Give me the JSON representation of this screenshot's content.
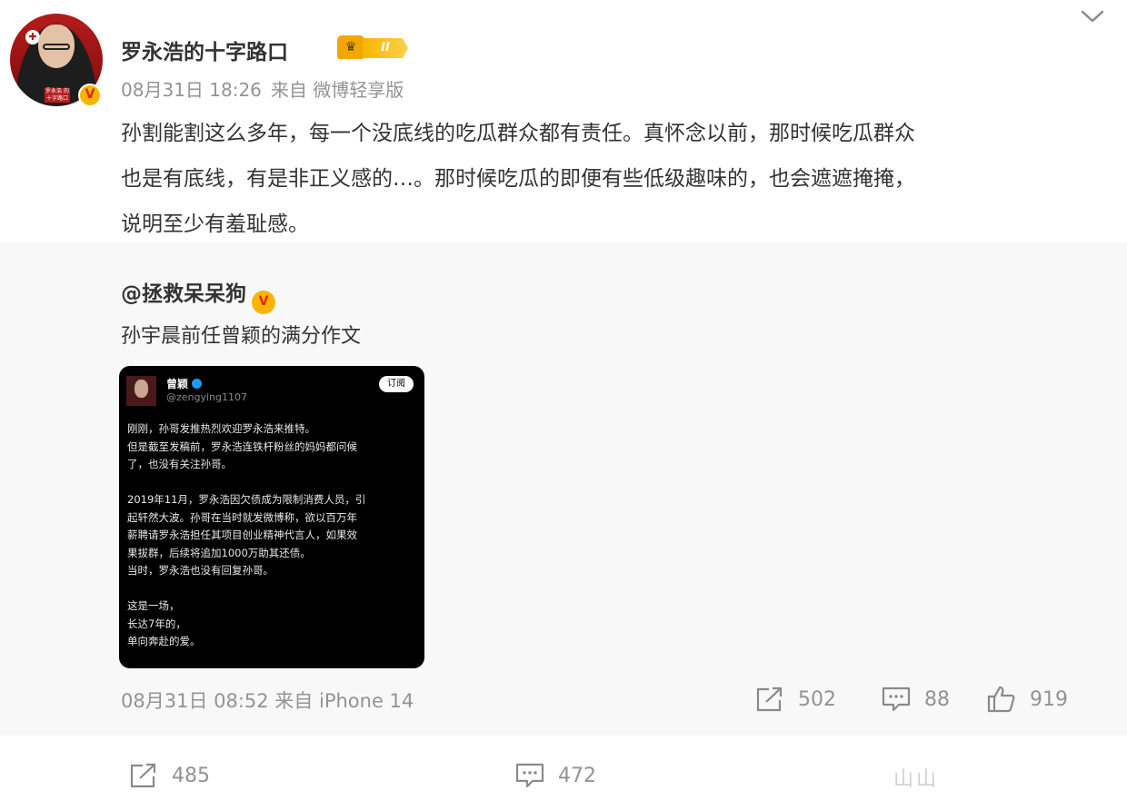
{
  "post": {
    "username": "罗永浩的十字路口",
    "level_badge": "II",
    "avatar_caption": "罗永浩 的十字路口",
    "meta": {
      "date": "08月31日 18:26",
      "source": "来自 微博轻享版"
    },
    "text_lines": [
      "孙割能割这么多年，每一个没底线的吃瓜群众都有责任。真怀念以前，那时候吃瓜群众",
      "也是有底线，有是非正义感的…。那时候吃瓜的即便有些低级趣味的，也会遮遮掩掩，",
      "说明至少有羞耻感。"
    ],
    "footer": {
      "repost": "485",
      "comment": "472",
      "like": "山山"
    }
  },
  "retweet": {
    "username": "@拯救呆呆狗",
    "text": "孙宇晨前任曾颖的满分作文",
    "image": {
      "name": "曾颖",
      "handle": "@zengying1107",
      "subscribe": "订阅",
      "paragraphs": [
        [
          "刚刚，孙哥发推热烈欢迎罗永浩来推特。",
          "但是截至发稿前，罗永浩连铁杆粉丝的妈妈都问候",
          "了，也没有关注孙哥。"
        ],
        [
          "2019年11月，罗永浩因欠债成为限制消费人员，引",
          "起轩然大波。孙哥在当时就发微博称，欲以百万年",
          "薪聘请罗永浩担任其项目创业精神代言人，如果效",
          "果拔群，后续将追加1000万助其还债。",
          "当时，罗永浩也没有回复孙哥。"
        ],
        [
          "这是一场，",
          "长达7年的，",
          "单向奔赴的爱。"
        ]
      ]
    },
    "time": "08月31日 08:52 来自 iPhone 14",
    "actions": {
      "repost": "502",
      "comment": "88",
      "like": "919"
    }
  },
  "colors": {
    "gray": "#939393",
    "retweet_bg": "#f8f8f8",
    "badge_gold": "#f7b500"
  },
  "icons": [
    "chevron-down-icon",
    "share-icon",
    "comment-icon",
    "like-icon",
    "verified-v-icon"
  ]
}
